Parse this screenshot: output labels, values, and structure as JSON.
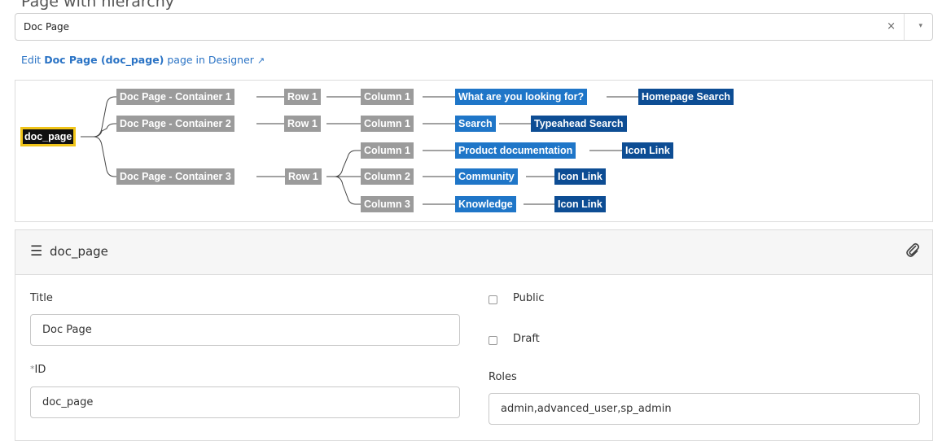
{
  "top_partial_text": "Page with hierarchy",
  "page_select": {
    "value": "Doc Page",
    "clear_label": "×",
    "arrow": "▾"
  },
  "edit_link": {
    "prefix": "Edit ",
    "page_name": "Doc Page (doc_page)",
    "suffix": " page in Designer",
    "icon": "external-link-icon"
  },
  "tree": {
    "root": "doc_page",
    "containers": [
      {
        "label": "Doc Page - Container 1",
        "row": "Row 1",
        "columns": [
          {
            "label": "Column 1",
            "widgets": [
              "What are you looking for?",
              "Homepage Search"
            ]
          }
        ]
      },
      {
        "label": "Doc Page - Container 2",
        "row": "Row 1",
        "columns": [
          {
            "label": "Column 1",
            "widgets": [
              "Search",
              "Typeahead Search"
            ]
          }
        ]
      },
      {
        "label": "Doc Page - Container 3",
        "row": "Row 1",
        "columns": [
          {
            "label": "Column 1",
            "widgets": [
              "Product documentation",
              "Icon Link"
            ]
          },
          {
            "label": "Column 2",
            "widgets": [
              "Community",
              "Icon Link"
            ]
          },
          {
            "label": "Column 3",
            "widgets": [
              "Knowledge",
              "Icon Link"
            ]
          }
        ]
      }
    ]
  },
  "form": {
    "header_title": "doc_page",
    "title_label": "Title",
    "title_value": "Doc Page",
    "required_mark": "*",
    "id_label": "ID",
    "id_value": "doc_page",
    "public_label": "Public",
    "draft_label": "Draft",
    "roles_label": "Roles",
    "roles_value": "admin,advanced_user,sp_admin"
  },
  "colors": {
    "link": "#2a73c5",
    "node_grey": "#9b9b9b",
    "node_blue": "#1f76c8",
    "node_navy": "#0d4d94",
    "root_border": "#f0c419"
  }
}
